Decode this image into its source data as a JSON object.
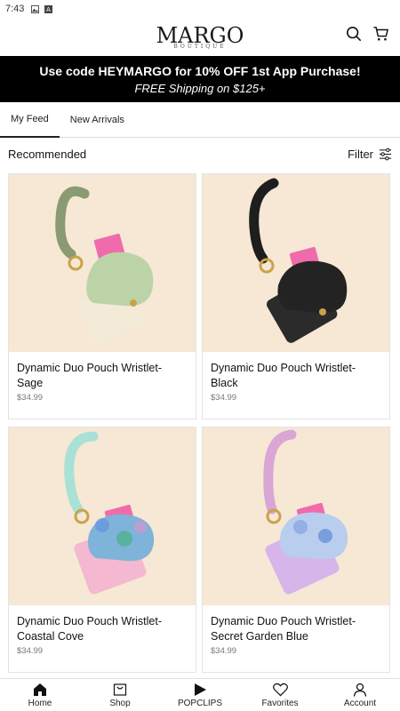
{
  "status_bar": {
    "time": "7:43"
  },
  "header": {
    "logo": "MARGO",
    "logo_sub": "BOUTIQUE"
  },
  "promo": {
    "line1": "Use code HEYMARGO for 10% OFF 1st App Purchase!",
    "line2": "FREE Shipping on $125+"
  },
  "tabs": [
    {
      "label": "My Feed",
      "active": true
    },
    {
      "label": "New Arrivals",
      "active": false
    }
  ],
  "section": {
    "title": "Recommended",
    "filter_label": "Filter"
  },
  "products": [
    {
      "name": "Dynamic Duo Pouch Wristlet-Sage",
      "price": "$34.99",
      "strap": "#8a9a72",
      "pouch": "#bcd3a8",
      "back": "#f3ead8"
    },
    {
      "name": "Dynamic Duo Pouch Wristlet-Black",
      "price": "$34.99",
      "strap": "#1e1e1e",
      "pouch": "#232323",
      "back": "#2b2b2b"
    },
    {
      "name": "Dynamic Duo Pouch Wristlet-Coastal Cove",
      "price": "$34.99",
      "strap": "#a9e1d6",
      "pouch": "#7fb3d9",
      "back": "#f4b8d0"
    },
    {
      "name": "Dynamic Duo Pouch Wristlet-Secret Garden Blue",
      "price": "$34.99",
      "strap": "#d9a6d6",
      "pouch": "#b9cdee",
      "back": "#d6b6ea"
    }
  ],
  "bottom_nav": [
    {
      "label": "Home",
      "icon": "home-icon"
    },
    {
      "label": "Shop",
      "icon": "shop-icon"
    },
    {
      "label": "POPCLIPS",
      "icon": "play-icon"
    },
    {
      "label": "Favorites",
      "icon": "heart-icon"
    },
    {
      "label": "Account",
      "icon": "person-icon"
    }
  ]
}
